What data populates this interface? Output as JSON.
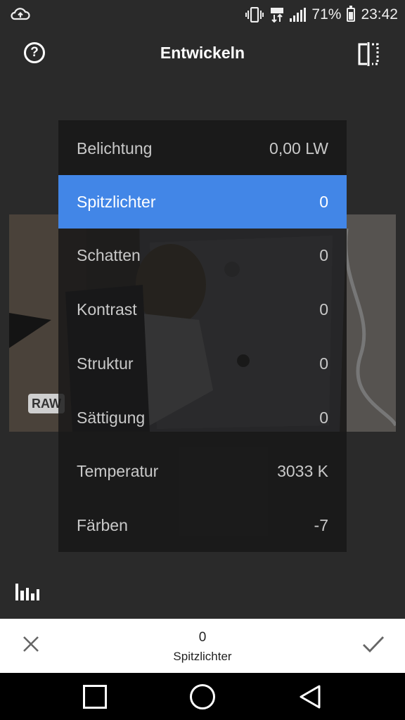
{
  "status_bar": {
    "battery_percent": "71%",
    "time": "23:42",
    "icons": [
      "cloud-upload-icon",
      "vibrate-icon",
      "data-transfer-icon",
      "signal-icon",
      "battery-icon"
    ]
  },
  "header": {
    "title": "Entwickeln",
    "help_icon": "help-icon",
    "compare_icon": "compare-icon"
  },
  "preview": {
    "badge": "RAW"
  },
  "adjustments": [
    {
      "label": "Belichtung",
      "value": "0,00 LW",
      "active": false
    },
    {
      "label": "Spitzlichter",
      "value": "0",
      "active": true
    },
    {
      "label": "Schatten",
      "value": "0",
      "active": false
    },
    {
      "label": "Kontrast",
      "value": "0",
      "active": false
    },
    {
      "label": "Struktur",
      "value": "0",
      "active": false
    },
    {
      "label": "Sättigung",
      "value": "0",
      "active": false
    },
    {
      "label": "Temperatur",
      "value": "3033 K",
      "active": false
    },
    {
      "label": "Färben",
      "value": "-7",
      "active": false
    }
  ],
  "bottom_panel": {
    "value": "0",
    "parameter": "Spitzlichter",
    "cancel_icon": "close-icon",
    "confirm_icon": "check-icon"
  },
  "colors": {
    "accent": "#4286e7",
    "background": "#2a2a2a",
    "menu_background": "#181818"
  },
  "navigation": {
    "icons": [
      "recent-apps-icon",
      "home-icon",
      "back-icon"
    ]
  }
}
